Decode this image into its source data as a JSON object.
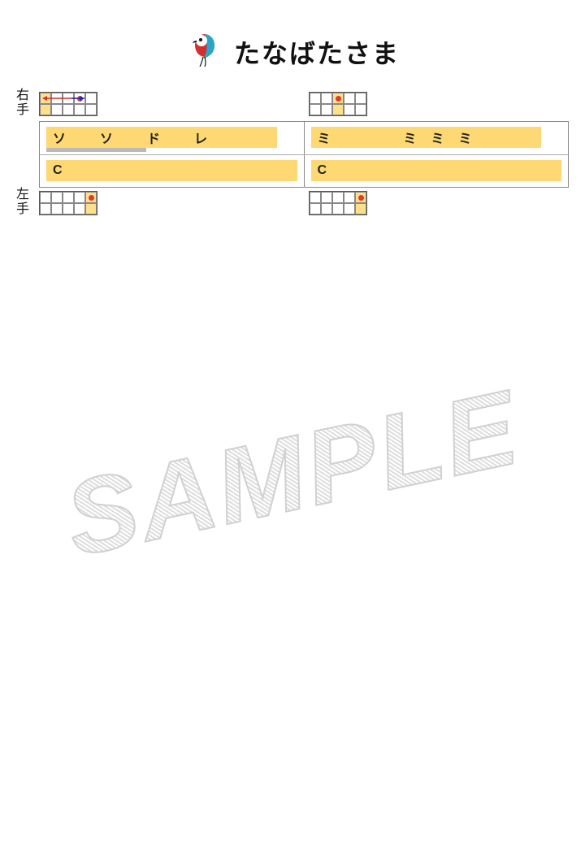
{
  "title": "たなばたさま",
  "labels": {
    "right_hand": "右手",
    "left_hand": "左手"
  },
  "measures": [
    {
      "notes": [
        "ソ",
        "ソ",
        "ド",
        "レ"
      ],
      "chord": "C",
      "gray_underbar": true
    },
    {
      "notes": [
        "ミ",
        "ミ",
        "ミ",
        "ミ"
      ],
      "chord": "C",
      "gray_underbar": false
    }
  ],
  "watermark": "SAMPLE",
  "grids": {
    "right_1": {
      "hl_col": 0,
      "dot": {
        "col": 3,
        "row": 0
      },
      "arrow": true
    },
    "right_2": {
      "hl_col": 2,
      "dot": {
        "col": 2,
        "row": 0
      }
    },
    "left_1": {
      "hl_col": 4,
      "dot": {
        "col": 4,
        "row": 0
      }
    },
    "left_2": {
      "hl_col": 4,
      "dot": {
        "col": 4,
        "row": 0
      }
    }
  }
}
